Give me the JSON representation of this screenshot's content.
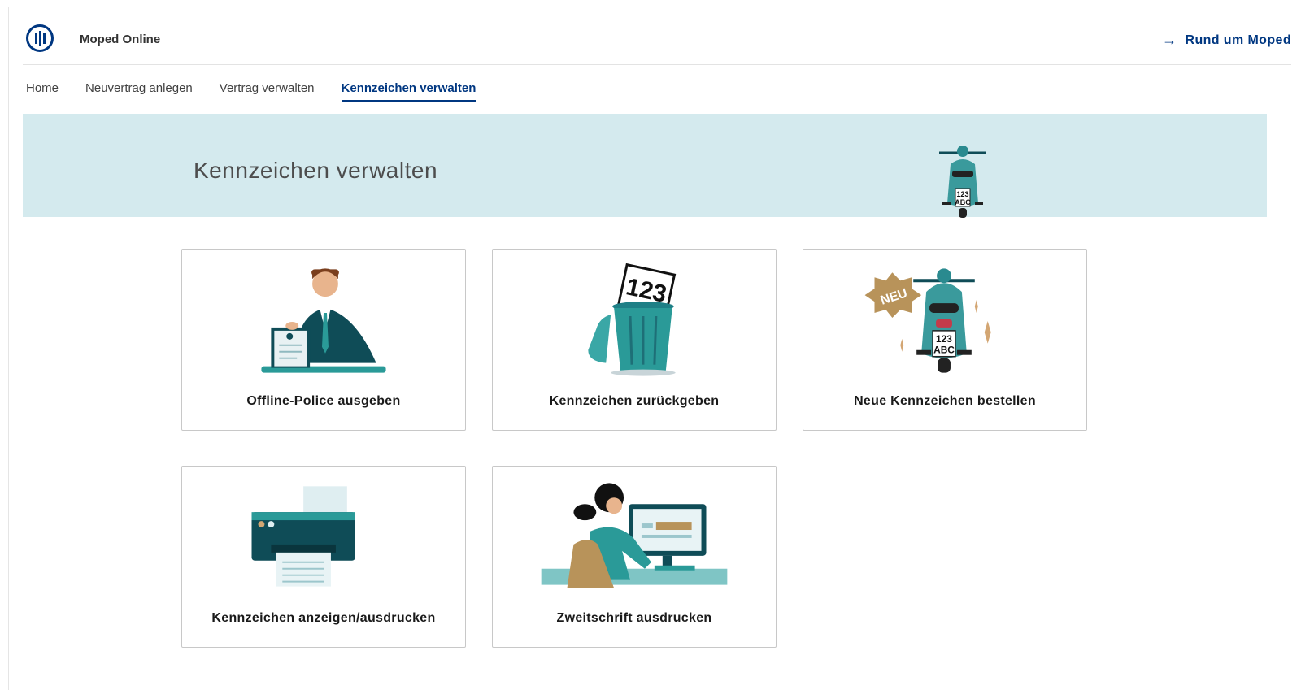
{
  "header": {
    "app_title": "Moped Online",
    "external_link_label": "Rund um Moped"
  },
  "nav": {
    "tabs": [
      {
        "label": "Home",
        "active": false
      },
      {
        "label": "Neuvertrag anlegen",
        "active": false
      },
      {
        "label": "Vertrag verwalten",
        "active": false
      },
      {
        "label": "Kennzeichen verwalten",
        "active": true
      }
    ]
  },
  "banner": {
    "title": "Kennzeichen verwalten",
    "plate_line1": "123",
    "plate_line2": "ABC"
  },
  "cards": [
    {
      "label": "Offline-Police ausgeben",
      "icon": "agent-at-desk-icon"
    },
    {
      "label": "Kennzeichen zurückgeben",
      "icon": "trash-can-plate-icon",
      "plate": "123"
    },
    {
      "label": "Neue Kennzeichen bestellen",
      "icon": "new-moped-icon",
      "badge": "NEU",
      "plate_line1": "123",
      "plate_line2": "ABC"
    },
    {
      "label": "Kennzeichen anzeigen/ausdrucken",
      "icon": "printer-icon"
    },
    {
      "label": "Zweitschrift ausdrucken",
      "icon": "woman-at-computer-icon"
    }
  ],
  "colors": {
    "brand": "#003781",
    "banner_bg": "#d4eaee",
    "teal": "#1e7f86",
    "dark_teal": "#0f4c57",
    "gold": "#b8935a"
  }
}
